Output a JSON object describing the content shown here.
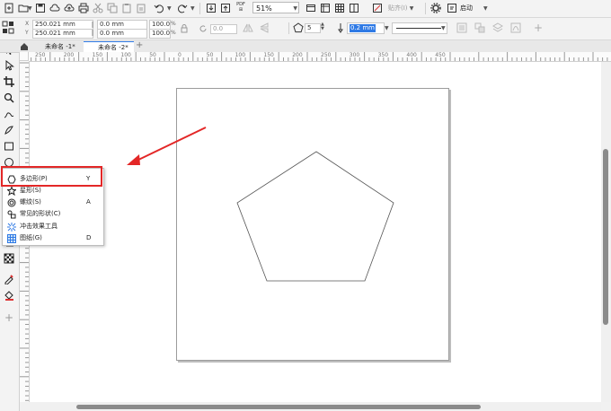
{
  "toolbar": {
    "zoom_value": "51%",
    "pdf_label": "PDF",
    "paste_label": "贴齐(I)",
    "launch_label": "启动"
  },
  "property_bar": {
    "pos_x": "250.021 mm",
    "pos_y": "250.021 mm",
    "width": "0.0 mm",
    "height": "0.0 mm",
    "scale_x": "100.0",
    "scale_y": "100.0",
    "percent_unit": "%",
    "angle": "0.0",
    "sides": "5",
    "outline_width": "0.2 mm"
  },
  "tabs": [
    {
      "label": "未命名 -1*"
    },
    {
      "label": "未命名 -2*"
    }
  ],
  "ruler_h": [
    "250",
    "200",
    "150",
    "100",
    "50",
    "0",
    "50",
    "100",
    "150",
    "200",
    "250",
    "300",
    "350",
    "400",
    "450"
  ],
  "flyout": {
    "items": [
      {
        "label": "多边形(P)",
        "key": "Y",
        "icon": "polygon-icon"
      },
      {
        "label": "星形(S)",
        "key": "",
        "icon": "star-icon"
      },
      {
        "label": "螺纹(S)",
        "key": "A",
        "icon": "spiral-icon"
      },
      {
        "label": "常见的形状(C)",
        "key": "",
        "icon": "common-shapes-icon"
      },
      {
        "label": "冲击效果工具",
        "key": "",
        "icon": "impact-effect-icon"
      },
      {
        "label": "图纸(G)",
        "key": "D",
        "icon": "graph-paper-icon"
      }
    ]
  },
  "annotation_color": "#e32727",
  "tools": [
    "pick-tool-icon",
    "shape-tool-icon",
    "crop-tool-icon",
    "zoom-tool-icon",
    "freehand-tool-icon",
    "artistic-media-icon",
    "rectangle-tool-icon",
    "ellipse-tool-icon",
    "polygon-tool-icon",
    "text-tool-icon",
    "dimension-tool-icon",
    "connector-tool-icon",
    "shadow-tool-icon",
    "transparency-tool-icon",
    "eyedropper-tool-icon",
    "fill-tool-icon",
    "add-tool-icon"
  ]
}
